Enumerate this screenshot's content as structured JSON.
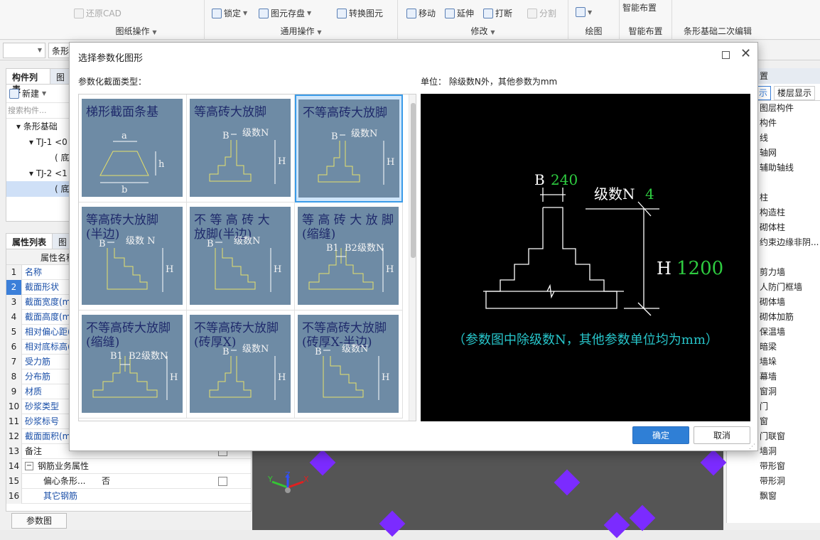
{
  "ribbon": {
    "items": [
      "还原CAD",
      "锁定",
      "图元存盘",
      "转换图元",
      "移动",
      "延伸",
      "打断",
      "分割",
      "智能布置"
    ],
    "groups": [
      "图纸操作",
      "通用操作",
      "修改",
      "绘图",
      "智能布置",
      "条形基础二次编辑"
    ]
  },
  "subbar": {
    "combo1": "",
    "combo2": "条形"
  },
  "left_panel": {
    "tabs": [
      "构件列表",
      "图"
    ],
    "new_label": "新建",
    "search_placeholder": "搜索构件...",
    "tree": [
      "条形基础",
      "TJ-1 <0",
      "( 底",
      "TJ-2 <1",
      "( 底"
    ]
  },
  "property_panel": {
    "tabs": [
      "属性列表",
      "图"
    ],
    "header": "属性名称",
    "rows": [
      {
        "num": "1",
        "name": "名称",
        "value": ""
      },
      {
        "num": "2",
        "name": "截面形状",
        "value": ""
      },
      {
        "num": "3",
        "name": "截面宽度(m",
        "value": ""
      },
      {
        "num": "4",
        "name": "截面高度(m",
        "value": ""
      },
      {
        "num": "5",
        "name": "相对偏心距(",
        "value": ""
      },
      {
        "num": "6",
        "name": "相对底标高(",
        "value": ""
      },
      {
        "num": "7",
        "name": "受力筋",
        "value": ""
      },
      {
        "num": "8",
        "name": "分布筋",
        "value": ""
      },
      {
        "num": "9",
        "name": "材质",
        "value": ""
      },
      {
        "num": "10",
        "name": "砂浆类型",
        "value": ""
      },
      {
        "num": "11",
        "name": "砂浆标号",
        "value": ""
      },
      {
        "num": "12",
        "name": "截面面积(m",
        "value": ""
      },
      {
        "num": "13",
        "name": "备注",
        "value": ""
      },
      {
        "num": "14",
        "name": "钢筋业务属性",
        "value": ""
      },
      {
        "num": "15",
        "name": "偏心条形...",
        "value": "否"
      },
      {
        "num": "16",
        "name": "其它钢筋",
        "value": ""
      }
    ],
    "param_tab": "参数图"
  },
  "right_panel": {
    "tabs": [
      "示",
      "楼层显示"
    ],
    "header": "置",
    "items": [
      "图层构件",
      "构件",
      "线",
      "轴网",
      "辅助轴线",
      "",
      "柱",
      "构造柱",
      "砌体柱",
      "约束边缘非阴...",
      "",
      "剪力墙",
      "人防门框墙",
      "砌体墙",
      "砌体加筋",
      "保温墙",
      "暗梁",
      "墙垛",
      "幕墙",
      "窗洞",
      "门",
      "窗",
      "门联窗",
      "墙洞",
      "带形窗",
      "带形洞",
      "飘窗"
    ]
  },
  "dialog": {
    "title": "选择参数化图形",
    "section_label": "参数化截面类型：",
    "unit_label": "单位：",
    "unit_desc": "除级数N外，其他参数为mm",
    "ok": "确定",
    "cancel": "取消",
    "shapes": [
      {
        "title1": "梯形截面条基",
        "title2": "",
        "kind": "trap",
        "labels": [
          "a",
          "h",
          "b"
        ]
      },
      {
        "title1": "等高砖大放脚",
        "title2": "",
        "kind": "full",
        "labels": [
          "B",
          "级数N",
          "H"
        ]
      },
      {
        "title1": "不等高砖大放脚",
        "title2": "",
        "kind": "full",
        "labels": [
          "B",
          "级数N",
          "H"
        ]
      },
      {
        "title1": "等高砖大放脚",
        "title2": "(半边)",
        "kind": "half",
        "labels": [
          "B",
          "级数 N",
          "H"
        ]
      },
      {
        "title1": "不 等 高 砖 大",
        "title2": "放脚(半边)",
        "kind": "half",
        "labels": [
          "B",
          "级数N",
          "H"
        ]
      },
      {
        "title1": "等 高 砖 大 放 脚",
        "title2": "(缩缝)",
        "kind": "gap",
        "labels": [
          "B1",
          "B2",
          "级数N",
          "H"
        ]
      },
      {
        "title1": "不等高砖大放脚",
        "title2": "(缩缝)",
        "kind": "gap",
        "labels": [
          "B1",
          "B2",
          "级数N",
          "H"
        ]
      },
      {
        "title1": "不等高砖大放脚",
        "title2": "(砖厚X)",
        "kind": "full",
        "labels": [
          "B",
          "级数N",
          "H"
        ]
      },
      {
        "title1": "不等高砖大放脚",
        "title2": "(砖厚X-半边)",
        "kind": "half",
        "labels": [
          "B",
          "级数N",
          "H"
        ]
      }
    ],
    "selected_index": 2,
    "preview": {
      "B_label": "B",
      "B_value": "240",
      "N_label": "级数N",
      "N_value": "4",
      "H_label": "H",
      "H_value": "1200",
      "note": "（参数图中除级数N，其他参数单位均为mm）"
    }
  },
  "colors": {
    "accent": "#2f7fd6",
    "thumb_bg": "#6e8ba5",
    "thumb_title": "#1f2a6b",
    "thumb_line": "#e6e06a",
    "preview_value": "#2ecc40",
    "preview_note": "#27c4c9"
  }
}
